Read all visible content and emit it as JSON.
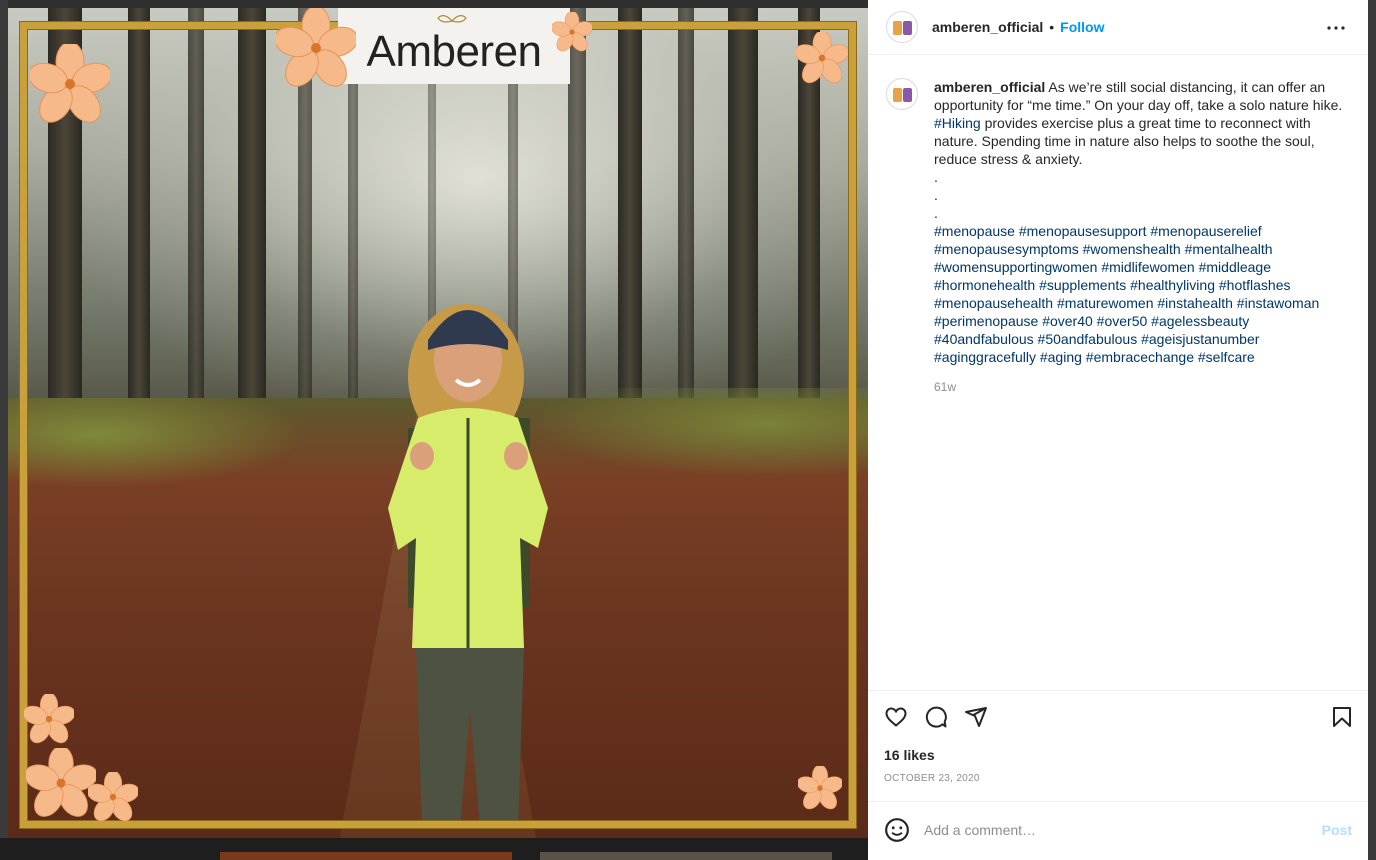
{
  "post": {
    "image": {
      "brand_logo": "Amberen",
      "accent_frame_color": "#c9a03a",
      "flower_color": "#f6b98a"
    },
    "header": {
      "username": "amberen_official",
      "separator": "•",
      "follow_label": "Follow",
      "more_icon": "more-horizontal-icon"
    },
    "caption": {
      "username": "amberen_official",
      "text_1": "As we’re still social distancing, it can offer an opportunity for “me time.” On your day off, take a solo nature hike. ",
      "hashtag_inline": "#Hiking",
      "text_2": " provides exercise plus a great time to reconnect with nature. Spending time in nature also helps to soothe the soul, reduce stress & anxiety.",
      "dots": [
        ".",
        ".",
        "."
      ],
      "hashtags": [
        "#menopause",
        "#menopausesupport",
        "#menopauserelief",
        "#menopausesymptoms",
        "#womenshealth",
        "#mentalhealth",
        "#womensupportingwomen",
        "#midlifewomen",
        "#middleage",
        "#hormonehealth",
        "#supplements",
        "#healthyliving",
        "#hotflashes",
        "#menopausehealth",
        "#maturewomen",
        "#instahealth",
        "#instawoman",
        "#perimenopause",
        "#over40",
        "#over50",
        "#agelessbeauty",
        "#40andfabulous",
        "#50andfabulous",
        "#ageisjustanumber",
        "#aginggracefully",
        "#aging",
        "#embracechange",
        "#selfcare"
      ],
      "time_ago": "61w"
    },
    "actions": {
      "icons": [
        "heart-icon",
        "comment-icon",
        "share-icon",
        "bookmark-icon"
      ],
      "likes": "16 likes",
      "date": "OCTOBER 23, 2020"
    },
    "comment": {
      "placeholder": "Add a comment…",
      "post_label": "Post",
      "emoji_icon": "emoji-icon"
    }
  }
}
